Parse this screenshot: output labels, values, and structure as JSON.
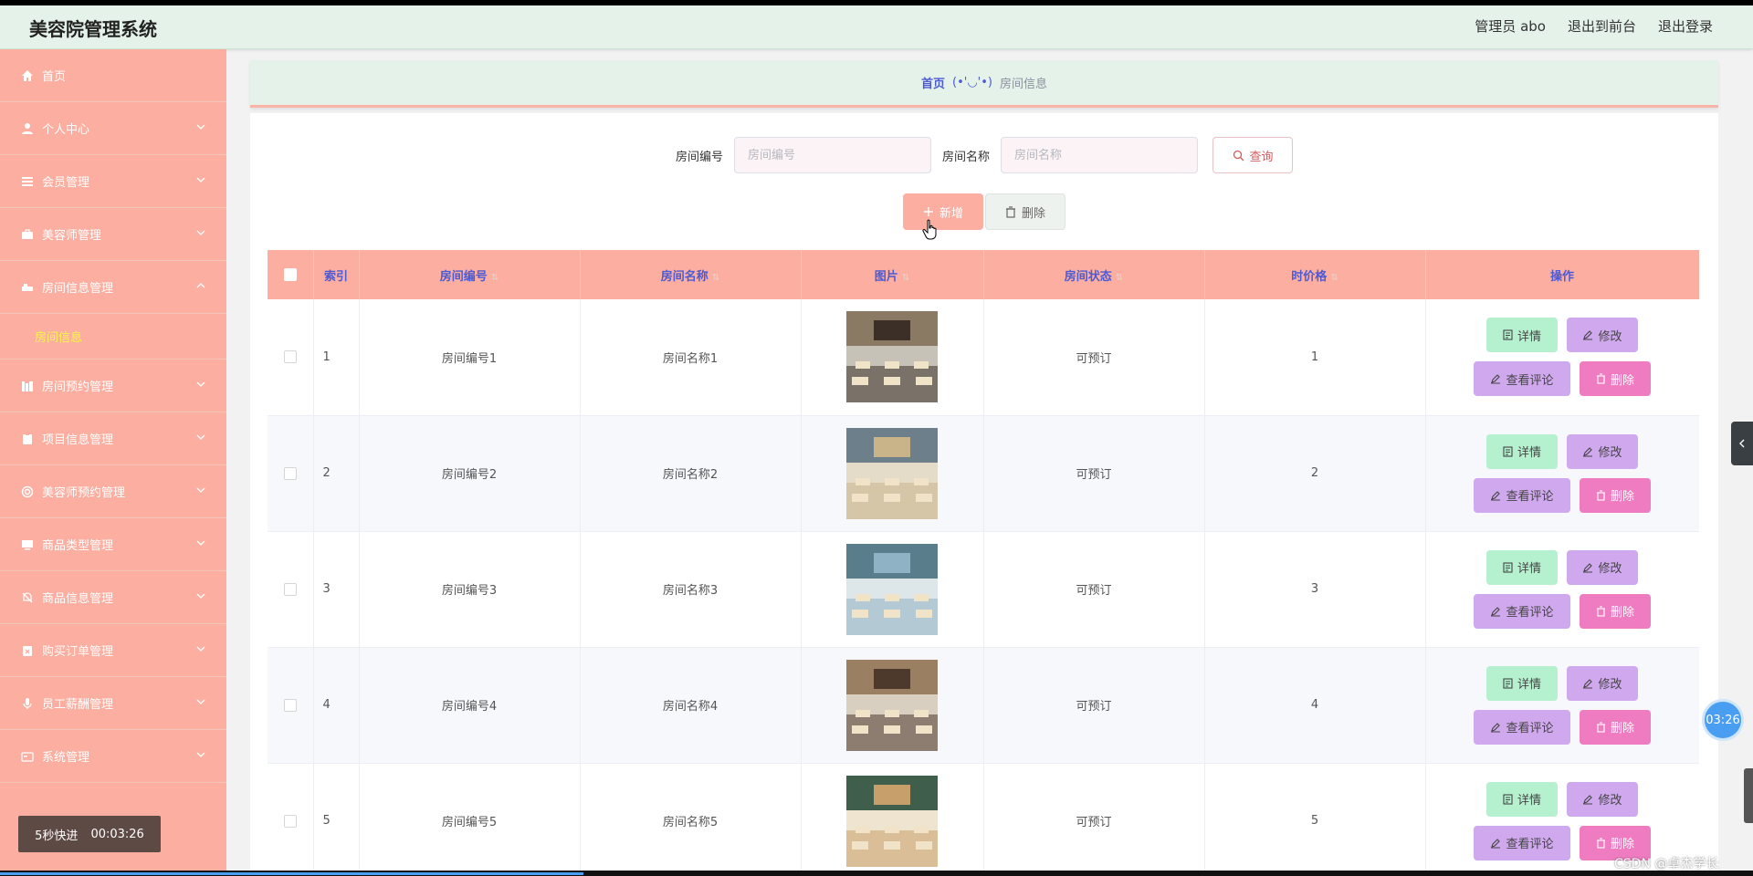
{
  "header": {
    "title": "美容院管理系统",
    "admin_label": "管理员 abo",
    "front_link": "退出到前台",
    "logout_link": "退出登录"
  },
  "sidebar": {
    "items": [
      {
        "label": "首页",
        "icon": "home-icon"
      },
      {
        "label": "个人中心",
        "icon": "user-icon"
      },
      {
        "label": "会员管理",
        "icon": "list-icon"
      },
      {
        "label": "美容师管理",
        "icon": "briefcase-icon"
      },
      {
        "label": "房间信息管理",
        "icon": "bed-icon"
      },
      {
        "label": "房间预约管理",
        "icon": "calendar-icon"
      },
      {
        "label": "项目信息管理",
        "icon": "clipboard-icon"
      },
      {
        "label": "美容师预约管理",
        "icon": "lifebuoy-icon"
      },
      {
        "label": "商品类型管理",
        "icon": "monitor-icon"
      },
      {
        "label": "商品信息管理",
        "icon": "bell-off-icon"
      },
      {
        "label": "购买订单管理",
        "icon": "order-icon"
      },
      {
        "label": "员工薪酬管理",
        "icon": "mic-icon"
      },
      {
        "label": "系统管理",
        "icon": "card-icon"
      }
    ],
    "sub_item": "房间信息"
  },
  "quick_badge": {
    "label": "5秒快进",
    "time": "00:03:26"
  },
  "breadcrumb": {
    "home": "首页",
    "separator": "(•'◡'•)",
    "current": "房间信息"
  },
  "search": {
    "field1_label": "房间编号",
    "field1_placeholder": "房间编号",
    "field2_label": "房间名称",
    "field2_placeholder": "房间名称",
    "query_label": "查询"
  },
  "actions": {
    "add_label": "新增",
    "delete_label": "删除"
  },
  "table": {
    "columns": [
      "索引",
      "房间编号",
      "房间名称",
      "图片",
      "房间状态",
      "时价格",
      "操作"
    ],
    "rows": [
      {
        "index": "1",
        "code": "房间编号1",
        "name": "房间名称1",
        "status": "可预订",
        "price": "1"
      },
      {
        "index": "2",
        "code": "房间编号2",
        "name": "房间名称2",
        "status": "可预订",
        "price": "2"
      },
      {
        "index": "3",
        "code": "房间编号3",
        "name": "房间名称3",
        "status": "可预订",
        "price": "3"
      },
      {
        "index": "4",
        "code": "房间编号4",
        "name": "房间名称4",
        "status": "可预订",
        "price": "4"
      },
      {
        "index": "5",
        "code": "房间编号5",
        "name": "房间名称5",
        "status": "可预订",
        "price": "5"
      }
    ],
    "ops": {
      "detail": "详情",
      "edit": "修改",
      "review": "查看评论",
      "delete": "删除"
    }
  },
  "overlays": {
    "timer": "03:26",
    "watermark": "CSDN @卓杰学长",
    "video_progress": 0.333
  },
  "colors": {
    "accent": "#fcaea0",
    "header_bg": "#e4f2ea",
    "active_sub": "#fff64b",
    "header_text": "#4c5bd4"
  }
}
